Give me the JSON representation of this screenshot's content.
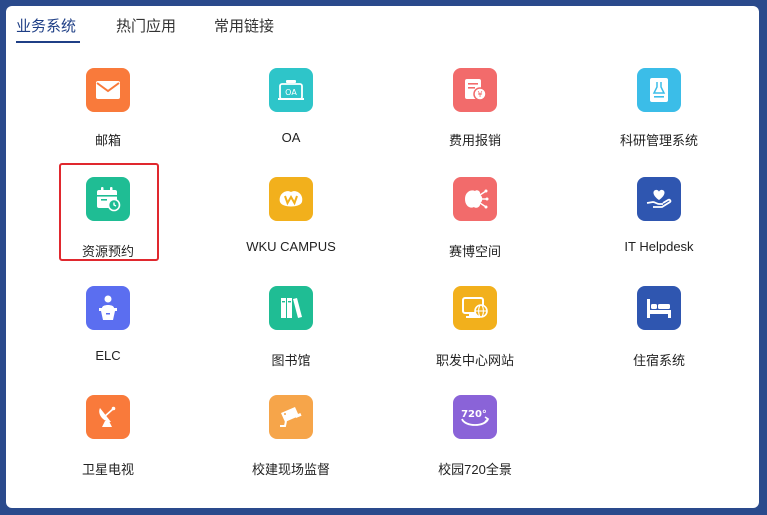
{
  "tabs": [
    {
      "label": "业务系统",
      "active": true
    },
    {
      "label": "热门应用",
      "active": false
    },
    {
      "label": "常用链接",
      "active": false
    }
  ],
  "apps": [
    {
      "label": "邮箱",
      "icon": "mail-icon",
      "color": "#f97a3b"
    },
    {
      "label": "OA",
      "icon": "oa-icon",
      "color": "#2ec5c9"
    },
    {
      "label": "费用报销",
      "icon": "expense-icon",
      "color": "#f26b6b"
    },
    {
      "label": "科研管理系统",
      "icon": "research-icon",
      "color": "#3bbde8"
    },
    {
      "label": "资源预约",
      "icon": "calendar-clock-icon",
      "color": "#1fbd94"
    },
    {
      "label": "WKU CAMPUS",
      "icon": "campus-logo-icon",
      "color": "#f2b01c"
    },
    {
      "label": "赛博空间",
      "icon": "cyber-icon",
      "color": "#f26b6b"
    },
    {
      "label": "IT Helpdesk",
      "icon": "helpdesk-heart-icon",
      "color": "#2f56b0"
    },
    {
      "label": "ELC",
      "icon": "lecturer-icon",
      "color": "#5b6ef0"
    },
    {
      "label": "图书馆",
      "icon": "library-books-icon",
      "color": "#1fbd94"
    },
    {
      "label": "职发中心网站",
      "icon": "web-globe-icon",
      "color": "#f2b01c"
    },
    {
      "label": "住宿系统",
      "icon": "bed-icon",
      "color": "#2f56b0"
    },
    {
      "label": "卫星电视",
      "icon": "satellite-dish-icon",
      "color": "#f97a3b"
    },
    {
      "label": "校建现场监督",
      "icon": "camera-icon",
      "color": "#f6a54a"
    },
    {
      "label": "校园720全景",
      "icon": "panorama-720-icon",
      "color": "#8a63d8"
    }
  ]
}
